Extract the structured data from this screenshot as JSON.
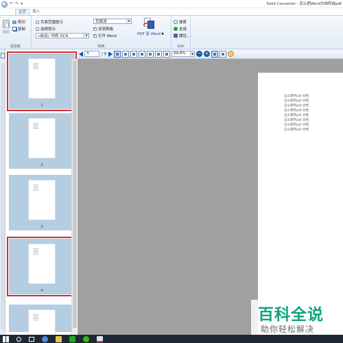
{
  "titlebar": {
    "qat_undo": "↶",
    "qat_redo": "↷",
    "qat_more": "▾",
    "title": "Solid Converter - 怎么把Word文档转成pdf"
  },
  "tabs": [
    {
      "label": "主页",
      "active": true
    },
    {
      "label": "加入",
      "active": false
    }
  ],
  "ribbon": {
    "clipboard": {
      "paste_label": "粘贴",
      "cut_label": "剪切",
      "copy_label": "复制",
      "group_label": "剪贴板"
    },
    "convert": {
      "page_range_label": "页面范围提示",
      "selection_hint_label": "选择提示",
      "ocr_value": "«自动» 中的 OCR",
      "page_flow_value": "页面流",
      "detect_tables_label": "侦测表格",
      "open_word_label": "打开 Word",
      "pdf_to_word_label": "PDF 至 Word",
      "group_label": "转换"
    },
    "edit": {
      "search_label": "搜索",
      "select_all_label": "全选",
      "properties_label": "属性...",
      "group_label": "Edit"
    }
  },
  "toolbar": {
    "current_page": "3",
    "of_pages": "/ 9",
    "zoom": "69.8%"
  },
  "thumbnails": [
    {
      "num": "1",
      "highlighted": true
    },
    {
      "num": "2",
      "highlighted": false
    },
    {
      "num": "3",
      "highlighted": false
    },
    {
      "num": "4",
      "highlighted": true
    }
  ],
  "document": {
    "lines": [
      "怎么转存pdf 文档",
      "怎么转存pdf 文档",
      "怎么转存pdf 文档",
      "怎么转存pdf 文档",
      "怎么转存pdf 文档",
      "怎么转存pdf 文档",
      "怎么转存pdf 文档",
      "怎么转存pdf 文档"
    ]
  },
  "watermark": {
    "brand": "百科全说",
    "slogan": "助你轻松解决"
  }
}
